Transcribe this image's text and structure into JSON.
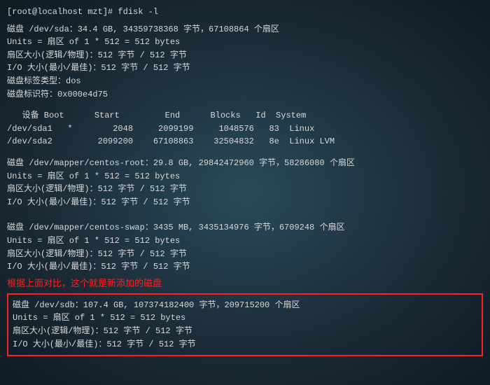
{
  "prompt": "[root@localhost mzt]# fdisk -l",
  "disk_sda": {
    "header": "磁盘 /dev/sda：34.4 GB, 34359738368 字节，67108864 个扇区",
    "units": "Units = 扇区 of 1 * 512 = 512 bytes",
    "sector": "扇区大小(逻辑/物理)：512 字节 / 512 字节",
    "io": "I/O 大小(最小/最佳)：512 字节 / 512 字节",
    "label": "磁盘标签类型：dos",
    "ident": "磁盘标识符：0x000e4d75"
  },
  "part_table": {
    "header": "   设备 Boot      Start         End      Blocks   Id  System",
    "row1": "/dev/sda1   *        2048     2099199     1048576   83  Linux",
    "row2": "/dev/sda2         2099200    67108863    32504832   8e  Linux LVM"
  },
  "disk_root": {
    "header": "磁盘 /dev/mapper/centos-root：29.8 GB, 29842472960 字节，58286080 个扇区",
    "units": "Units = 扇区 of 1 * 512 = 512 bytes",
    "sector": "扇区大小(逻辑/物理)：512 字节 / 512 字节",
    "io": "I/O 大小(最小/最佳)：512 字节 / 512 字节"
  },
  "disk_swap": {
    "header": "磁盘 /dev/mapper/centos-swap：3435 MB, 3435134976 字节，6709248 个扇区",
    "units": "Units = 扇区 of 1 * 512 = 512 bytes",
    "sector": "扇区大小(逻辑/物理)：512 字节 / 512 字节",
    "io": "I/O 大小(最小/最佳)：512 字节 / 512 字节"
  },
  "annotation": "根据上面对比，这个就是新添加的磁盘",
  "disk_sdb": {
    "header": "磁盘 /dev/sdb：107.4 GB, 107374182400 字节，209715200 个扇区",
    "units": "Units = 扇区 of 1 * 512 = 512 bytes",
    "sector": "扇区大小(逻辑/物理)：512 字节 / 512 字节",
    "io": "I/O 大小(最小/最佳)：512 字节 / 512 字节"
  }
}
